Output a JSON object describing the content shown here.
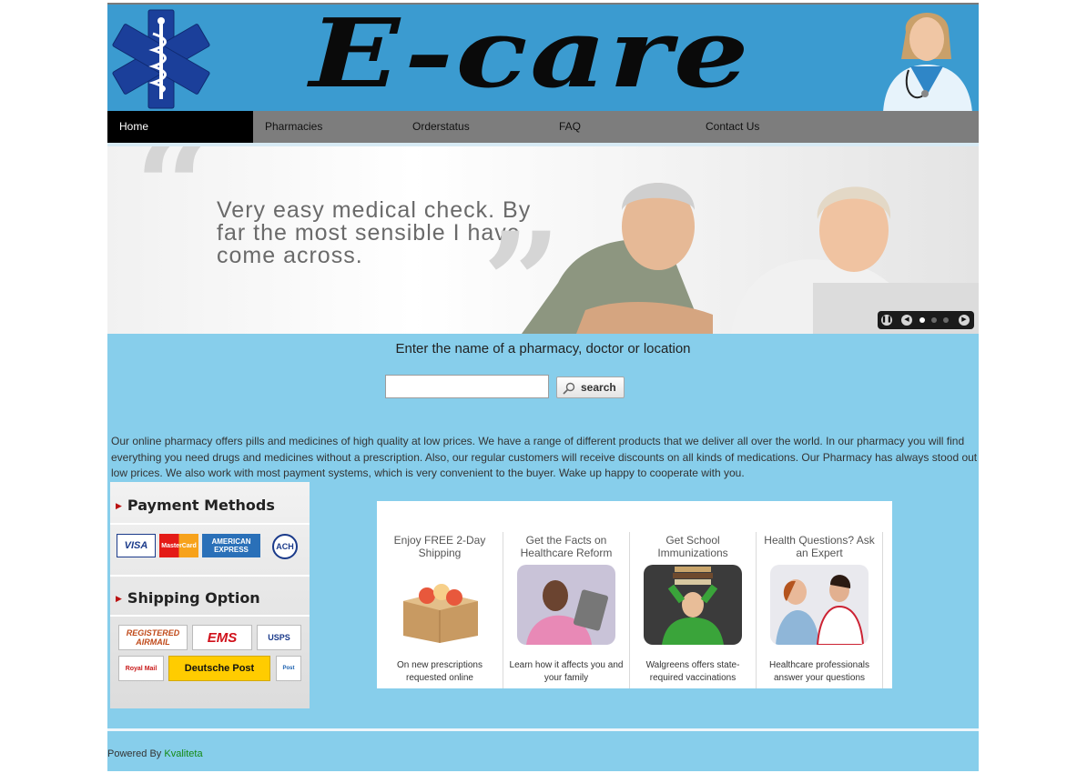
{
  "header": {
    "brand": "E-care"
  },
  "nav": {
    "items": [
      {
        "label": "Home",
        "active": true
      },
      {
        "label": "Pharmacies"
      },
      {
        "label": "Orderstatus"
      },
      {
        "label": "FAQ"
      },
      {
        "label": "Contact Us"
      }
    ]
  },
  "banner": {
    "quote": "Very easy medical check. By far the most sensible I have come across.",
    "slider": {
      "active_slide": 1,
      "slide_count": 4
    }
  },
  "search": {
    "prompt": "Enter the name of a pharmacy, doctor or location",
    "value": "",
    "button_label": "search"
  },
  "description": "Our online pharmacy offers pills and medicines of high quality at low prices. We have a range of different products that we deliver all over the world. In our pharmacy you will find everything you need drugs and medicines without a prescription. Also, our regular customers will receive discounts on all kinds of medications. Our Pharmacy has always stood out low prices. We also work with most payment systems, which is very convenient to the buyer. Wake up happy to cooperate with you.",
  "sidebar": {
    "payment_title": "Payment Methods",
    "payment_logos": [
      "VISA",
      "MasterCard",
      "AMERICAN EXPRESS",
      "ACH"
    ],
    "shipping_title": "Shipping Option",
    "shipping_logos": [
      "REGISTERED AIRMAIL",
      "EMS",
      "USPS",
      "Royal Mail",
      "Deutsche Post",
      "Post"
    ]
  },
  "promo": {
    "items": [
      {
        "title": "Enjoy FREE 2-Day Shipping",
        "caption": "On new prescriptions requested online"
      },
      {
        "title": "Get the Facts on Healthcare Reform",
        "caption": "Learn how it affects you and your family"
      },
      {
        "title": "Get School Immunizations",
        "caption": "Walgreens offers state-required vaccinations"
      },
      {
        "title": "Health Questions? Ask an Expert",
        "caption": "Healthcare professionals answer your questions"
      }
    ]
  },
  "footer": {
    "prefix": "Powered By ",
    "link": "Kvaliteta"
  },
  "colors": {
    "page_bg": "#87ceeb",
    "header_bg": "#3b9bd0",
    "nav_bg": "#7d7d7d",
    "nav_active": "#000000",
    "footer_link": "#148a14"
  }
}
